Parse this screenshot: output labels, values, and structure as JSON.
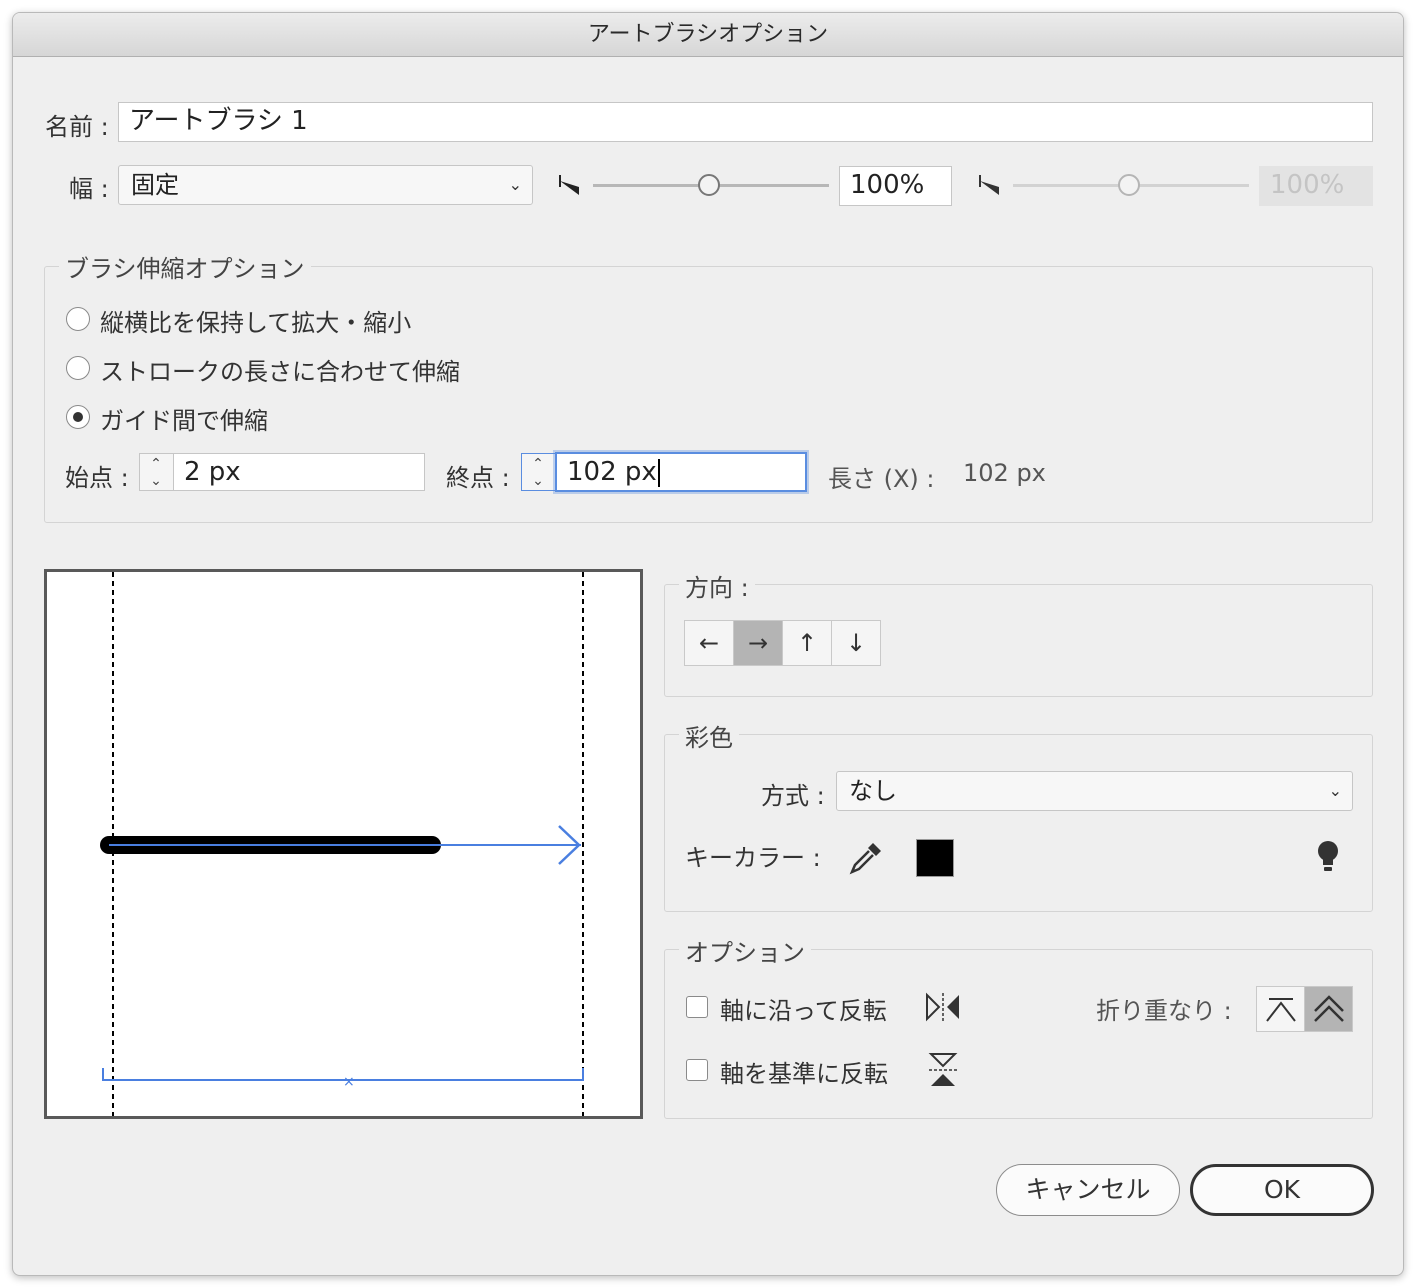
{
  "window": {
    "title": "アートブラシオプション"
  },
  "name_row": {
    "label": "名前 :",
    "value": "アートブラシ 1"
  },
  "width_row": {
    "label": "幅 :",
    "select_value": "固定",
    "min_value": "100%",
    "max_value": "100%"
  },
  "stretch_group": {
    "title": "ブラシ伸縮オプション",
    "options": [
      {
        "label": "縦横比を保持して拡大・縮小",
        "selected": false
      },
      {
        "label": "ストロークの長さに合わせて伸縮",
        "selected": false
      },
      {
        "label": "ガイド間で伸縮",
        "selected": true
      }
    ],
    "start_label": "始点 :",
    "start_value": "2 px",
    "end_label": "終点 :",
    "end_value": "102 px",
    "length_label": "長さ (X) :",
    "length_value": "102 px"
  },
  "direction_group": {
    "title": "方向 :",
    "buttons": [
      {
        "glyph": "←",
        "icon": "arrow-left-icon",
        "selected": false
      },
      {
        "glyph": "→",
        "icon": "arrow-right-icon",
        "selected": true
      },
      {
        "glyph": "↑",
        "icon": "arrow-up-icon",
        "selected": false
      },
      {
        "glyph": "↓",
        "icon": "arrow-down-icon",
        "selected": false
      }
    ]
  },
  "color_group": {
    "title": "彩色",
    "method_label": "方式 :",
    "method_value": "なし",
    "keycolor_label": "キーカラー :",
    "keycolor_swatch": "#000000"
  },
  "options_group": {
    "title": "オプション",
    "flip_along_label": "軸に沿って反転",
    "flip_across_label": "軸を基準に反転",
    "overlap_label": "折り重なり :"
  },
  "buttons": {
    "cancel": "キャンセル",
    "ok": "OK"
  },
  "colors": {
    "accent": "#4a7fe0",
    "focus": "#5a8de0",
    "stroke": "#000000"
  }
}
